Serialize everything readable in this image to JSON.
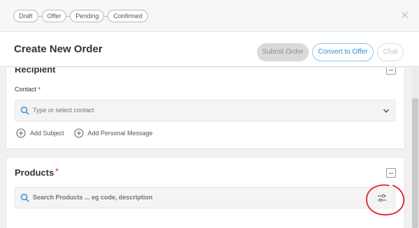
{
  "workflow": {
    "steps": [
      "Draft",
      "Offer",
      "Pending",
      "Confirmed"
    ]
  },
  "window": {
    "close_icon": "close-icon"
  },
  "header": {
    "title": "Create New Order",
    "submit_label": "Submit Order",
    "convert_label": "Convert to Offer",
    "chat_label": "Chat"
  },
  "recipient": {
    "title": "Recipient",
    "contact_label": "Contact",
    "required_mark": "*",
    "contact_placeholder": "Type or select contact",
    "add_subject_label": "Add Subject",
    "add_message_label": "Add Personal Message"
  },
  "products": {
    "title": "Products",
    "required_mark": "*",
    "search_placeholder": "Search Products ... eg code, description"
  },
  "colors": {
    "accent": "#2a8fd6",
    "required": "#e74c3c",
    "annotation": "#e0202a"
  }
}
